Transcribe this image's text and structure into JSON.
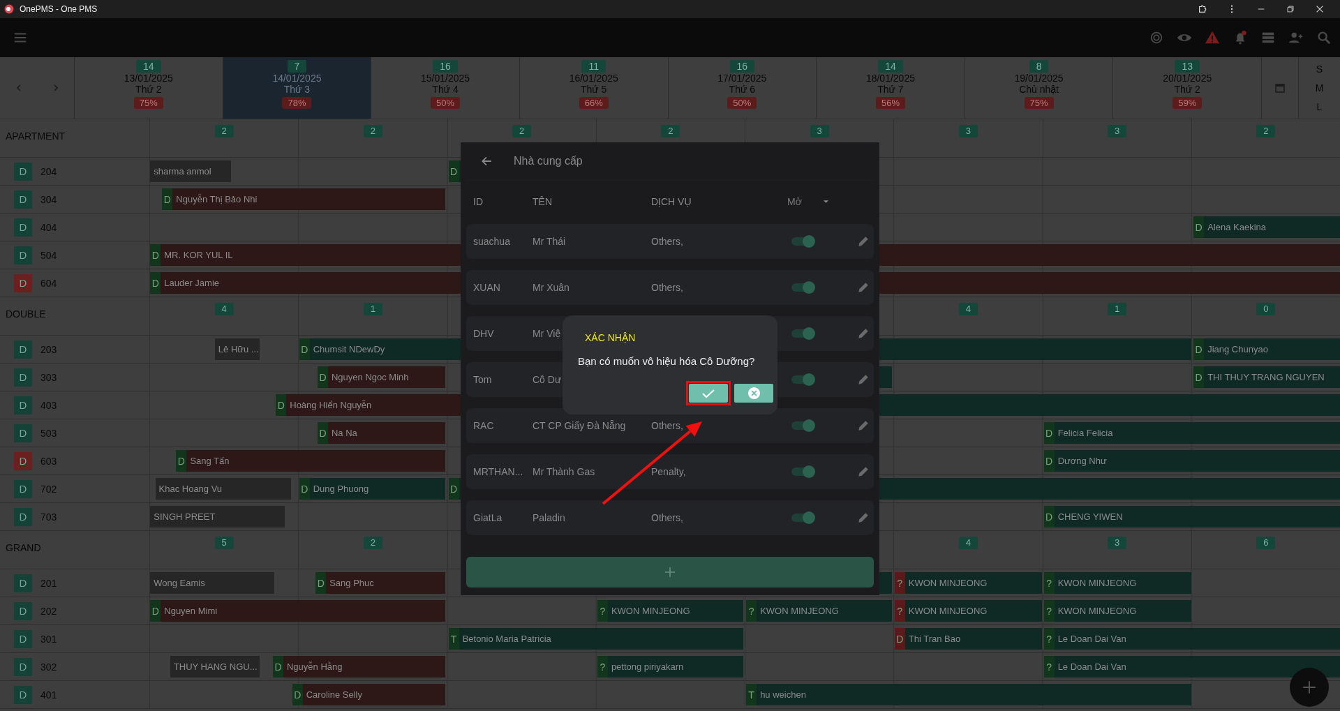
{
  "window": {
    "title": "OnePMS - One PMS"
  },
  "calendar_header": {
    "days": [
      {
        "count": "14",
        "date": "13/01/2025",
        "weekday": "Thứ 2",
        "occupancy": "75%",
        "selected": false
      },
      {
        "count": "7",
        "date": "14/01/2025",
        "weekday": "Thứ 3",
        "occupancy": "78%",
        "selected": true
      },
      {
        "count": "16",
        "date": "15/01/2025",
        "weekday": "Thứ 4",
        "occupancy": "50%",
        "selected": false
      },
      {
        "count": "11",
        "date": "16/01/2025",
        "weekday": "Thứ 5",
        "occupancy": "66%",
        "selected": false
      },
      {
        "count": "16",
        "date": "17/01/2025",
        "weekday": "Thứ 6",
        "occupancy": "50%",
        "selected": false
      },
      {
        "count": "14",
        "date": "18/01/2025",
        "weekday": "Thứ 7",
        "occupancy": "56%",
        "selected": false
      },
      {
        "count": "8",
        "date": "19/01/2025",
        "weekday": "Chủ nhật",
        "occupancy": "75%",
        "selected": false
      },
      {
        "count": "13",
        "date": "20/01/2025",
        "weekday": "Thứ 2",
        "occupancy": "59%",
        "selected": false
      }
    ],
    "sizes": [
      "S",
      "M",
      "L"
    ]
  },
  "sections": [
    {
      "name": "APARTMENT",
      "counts": [
        "2",
        "2",
        "2",
        "2",
        "3",
        "3",
        "3",
        "2"
      ],
      "rooms": [
        {
          "number": "204",
          "tag": "D",
          "color": "#144236",
          "bookings": [
            {
              "guest": "sharma anmol",
              "color": "#262626"
            },
            {
              "tag": {
                "text": "D",
                "color": "#12361c"
              },
              "color": "#0f2a25"
            }
          ]
        },
        {
          "number": "304",
          "tag": "D",
          "color": "#144236",
          "bookings": [
            {
              "tag": {
                "text": "D",
                "color": "#12361c"
              },
              "guest": "Nguyễn Thị Bảo Nhi",
              "color": "#2d1717"
            }
          ]
        },
        {
          "number": "404",
          "tag": "D",
          "color": "#144236",
          "bookings": [
            {
              "tag": {
                "text": "D",
                "color": "#12361c"
              },
              "guest": "Alena Kaekina",
              "color": "#0f2a25"
            }
          ]
        },
        {
          "number": "504",
          "tag": "D",
          "color": "#144236",
          "bookings": [
            {
              "tag": {
                "text": "D",
                "color": "#12361c"
              },
              "guest": "MR. KOR YUL IL",
              "color": "#2d1717"
            }
          ]
        },
        {
          "number": "604",
          "tag": "D",
          "color": "#6b1f1f",
          "bookings": [
            {
              "tag": {
                "text": "D",
                "color": "#12361c"
              },
              "guest": "Lauder Jamie",
              "color": "#2d1717"
            }
          ]
        }
      ]
    },
    {
      "name": "DOUBLE",
      "counts": [
        "4",
        "1",
        "4",
        "1",
        "0"
      ],
      "rooms": [
        {
          "number": "203",
          "tag": "D",
          "color": "#144236",
          "bookings": [
            {
              "guest": "Lê Hữu ...",
              "color": "#262626"
            },
            {
              "tag": {
                "text": "D",
                "color": "#12361c"
              },
              "guest": "Chumsit NDewDy",
              "color": "#0f2a25"
            },
            {
              "tag": {
                "text": "D",
                "color": "#12361c"
              },
              "guest": "Jiang Chunyao",
              "color": "#0f2a25"
            }
          ]
        },
        {
          "number": "303",
          "tag": "D",
          "color": "#144236",
          "bookings": [
            {
              "tag": {
                "text": "D",
                "color": "#12361c"
              },
              "guest": "Nguyen Ngoc Minh",
              "color": "#2d1717"
            },
            {
              "color": "#0f2a25"
            },
            {
              "tag": {
                "text": "D",
                "color": "#12361c"
              },
              "guest": "THI THUY TRANG NGUYEN",
              "color": "#0f2a25"
            }
          ]
        },
        {
          "number": "403",
          "tag": "D",
          "color": "#144236",
          "bookings": [
            {
              "tag": {
                "text": "D",
                "color": "#12361c"
              },
              "guest": "Hoàng Hiển Nguyễn",
              "color": "#2d1717"
            },
            {
              "color": "#0f2a25"
            }
          ]
        },
        {
          "number": "503",
          "tag": "D",
          "color": "#144236",
          "bookings": [
            {
              "tag": {
                "text": "D",
                "color": "#12361c"
              },
              "guest": "Na Na",
              "color": "#2d1717"
            },
            {
              "tag": {
                "text": "D",
                "color": "#12361c"
              },
              "guest": "Felicia Felicia",
              "color": "#0f2a25"
            }
          ]
        },
        {
          "number": "603",
          "tag": "D",
          "color": "#6b1f1f",
          "bookings": [
            {
              "tag": {
                "text": "D",
                "color": "#12361c"
              },
              "guest": "Sang Tấn",
              "color": "#2d1717"
            },
            {
              "tag": {
                "text": "D",
                "color": "#12361c"
              },
              "guest": "Dương Như",
              "color": "#0f2a25"
            }
          ]
        },
        {
          "number": "702",
          "tag": "D",
          "color": "#144236",
          "bookings": [
            {
              "guest": "Khac Hoang Vu",
              "color": "#262626"
            },
            {
              "tag": {
                "text": "D",
                "color": "#12361c"
              },
              "guest": "Dung Phuong",
              "color": "#0f2a25"
            },
            {
              "tag": {
                "text": "D",
                "color": "#12361c"
              },
              "color": "#0f2a25"
            }
          ]
        },
        {
          "number": "703",
          "tag": "D",
          "color": "#144236",
          "bookings": [
            {
              "guest": "SINGH PREET",
              "color": "#262626"
            },
            {
              "tag": {
                "text": "D",
                "color": "#12361c"
              },
              "guest": "CHENG YIWEN",
              "color": "#0f2a25"
            }
          ]
        }
      ]
    },
    {
      "name": "GRAND",
      "counts": [
        "5",
        "2",
        "4",
        "3",
        "6"
      ],
      "rooms": [
        {
          "number": "201",
          "tag": "D",
          "color": "#144236",
          "bookings": [
            {
              "guest": "Wong Eamis",
              "color": "#262626"
            },
            {
              "tag": {
                "text": "D",
                "color": "#12361c"
              },
              "guest": "Sang Phuc",
              "color": "#2d1717"
            },
            {
              "color": "#0f2a25"
            },
            {
              "tag": {
                "text": "?",
                "color": "#5a1a1a"
              },
              "guest": "KWON MINJEONG",
              "color": "#0f2a25"
            },
            {
              "tag": {
                "text": "?",
                "color": "#12361c"
              },
              "guest": "KWON MINJEONG",
              "color": "#0f2a25"
            }
          ]
        },
        {
          "number": "202",
          "tag": "D",
          "color": "#144236",
          "bookings": [
            {
              "tag": {
                "text": "D",
                "color": "#12361c"
              },
              "guest": "Nguyen Mimi",
              "color": "#2d1717"
            },
            {
              "tag": {
                "text": "?",
                "color": "#12361c"
              },
              "guest": "KWON MINJEONG",
              "color": "#0f2a25"
            },
            {
              "tag": {
                "text": "?",
                "color": "#12361c"
              },
              "guest": "KWON MINJEONG",
              "color": "#0f2a25"
            },
            {
              "tag": {
                "text": "?",
                "color": "#5a1a1a"
              },
              "guest": "KWON MINJEONG",
              "color": "#0f2a25"
            },
            {
              "tag": {
                "text": "?",
                "color": "#12361c"
              },
              "guest": "KWON MINJEONG",
              "color": "#0f2a25"
            }
          ]
        },
        {
          "number": "301",
          "tag": "D",
          "color": "#144236",
          "bookings": [
            {
              "tag": {
                "text": "T",
                "color": "#12361c"
              },
              "guest": "Betonio Maria Patricia",
              "color": "#0f2a25"
            },
            {
              "tag": {
                "text": "D",
                "color": "#5a1a1a"
              },
              "guest": "Thi Tran Bao",
              "color": "#0f2a25"
            },
            {
              "tag": {
                "text": "?",
                "color": "#12361c"
              },
              "guest": "Le Doan Dai Van",
              "color": "#0f2a25"
            }
          ]
        },
        {
          "number": "302",
          "tag": "D",
          "color": "#144236",
          "bookings": [
            {
              "guest": "THUY HANG NGU...",
              "color": "#262626"
            },
            {
              "tag": {
                "text": "D",
                "color": "#12361c"
              },
              "guest": "Nguyễn Hằng",
              "color": "#2d1717"
            },
            {
              "tag": {
                "text": "?",
                "color": "#12361c"
              },
              "guest": "pettong piriyakarn",
              "color": "#0f2a25"
            },
            {
              "tag": {
                "text": "?",
                "color": "#12361c"
              },
              "guest": "Le Doan Dai Van",
              "color": "#0f2a25"
            }
          ]
        },
        {
          "number": "401",
          "tag": "D",
          "color": "#144236",
          "bookings": [
            {
              "tag": {
                "text": "D",
                "color": "#12361c"
              },
              "guest": "Caroline Selly",
              "color": "#2d1717"
            },
            {
              "tag": {
                "text": "T",
                "color": "#12361c"
              },
              "guest": "hu weichen",
              "color": "#0f2a25"
            }
          ]
        }
      ]
    }
  ],
  "supplier_panel": {
    "title": "Nhà cung cấp",
    "columns": [
      "ID",
      "TÊN",
      "DỊCH VỤ"
    ],
    "status_filter": "Mở",
    "rows": [
      {
        "id": "suachua",
        "name": "Mr Thái",
        "service": "Others,",
        "on": true
      },
      {
        "id": "XUAN",
        "name": "Mr Xuân",
        "service": "Others,",
        "on": true
      },
      {
        "id": "DHV",
        "name": "Mr Việ",
        "on": true
      },
      {
        "id": "Tom",
        "name": "Cô Dư",
        "on": true
      },
      {
        "id": "RAC",
        "name": "CT CP Giấy Đà Nẵng",
        "service": "Others,",
        "on": true
      },
      {
        "id": "MRTHAN...",
        "name": "Mr Thành Gas",
        "service": "Penalty,",
        "on": true
      },
      {
        "id": "GiatLa",
        "name": "Paladin",
        "service": "Others,",
        "on": true
      }
    ]
  },
  "confirm_dialog": {
    "title": "XÁC NHẬN",
    "message": "Bạn có muốn vô hiệu hóa Cô Dưỡng?"
  }
}
